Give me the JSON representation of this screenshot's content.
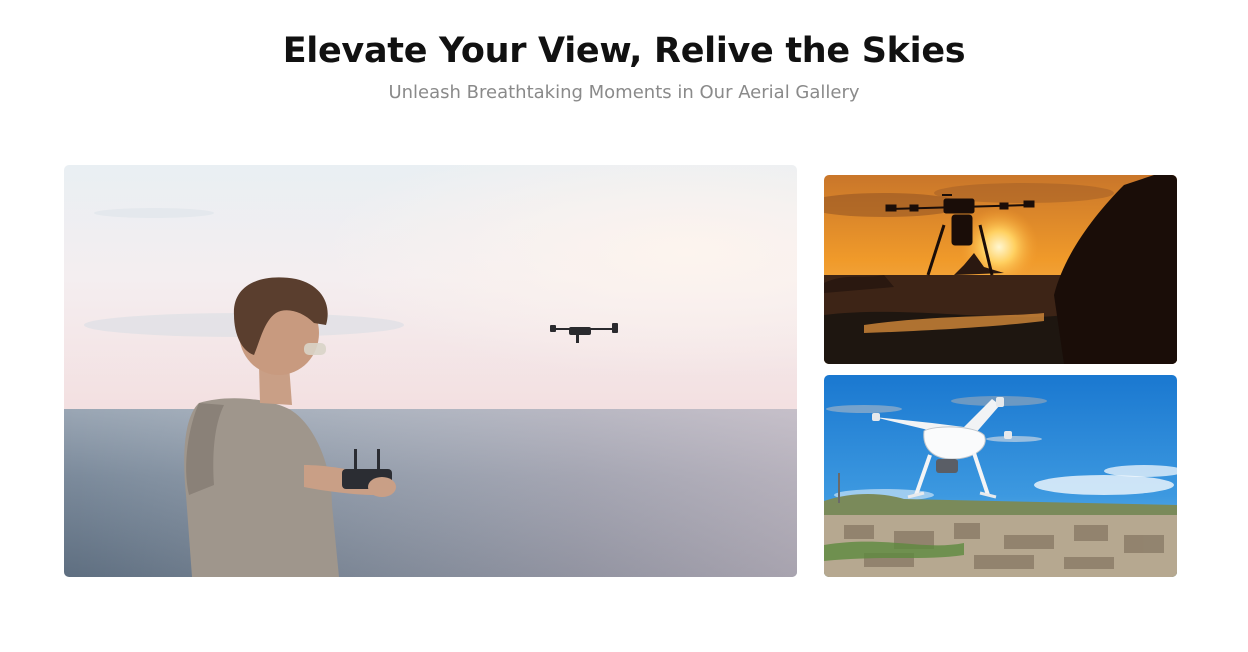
{
  "header": {
    "title": "Elevate Your View, Relive the Skies",
    "subtitle": "Unleash Breathtaking Moments in Our Aerial Gallery"
  },
  "gallery": {
    "images": [
      {
        "subject": "person-flying-drone-over-sea"
      },
      {
        "subject": "drone-silhouette-at-sunset"
      },
      {
        "subject": "white-drone-over-city"
      }
    ]
  }
}
